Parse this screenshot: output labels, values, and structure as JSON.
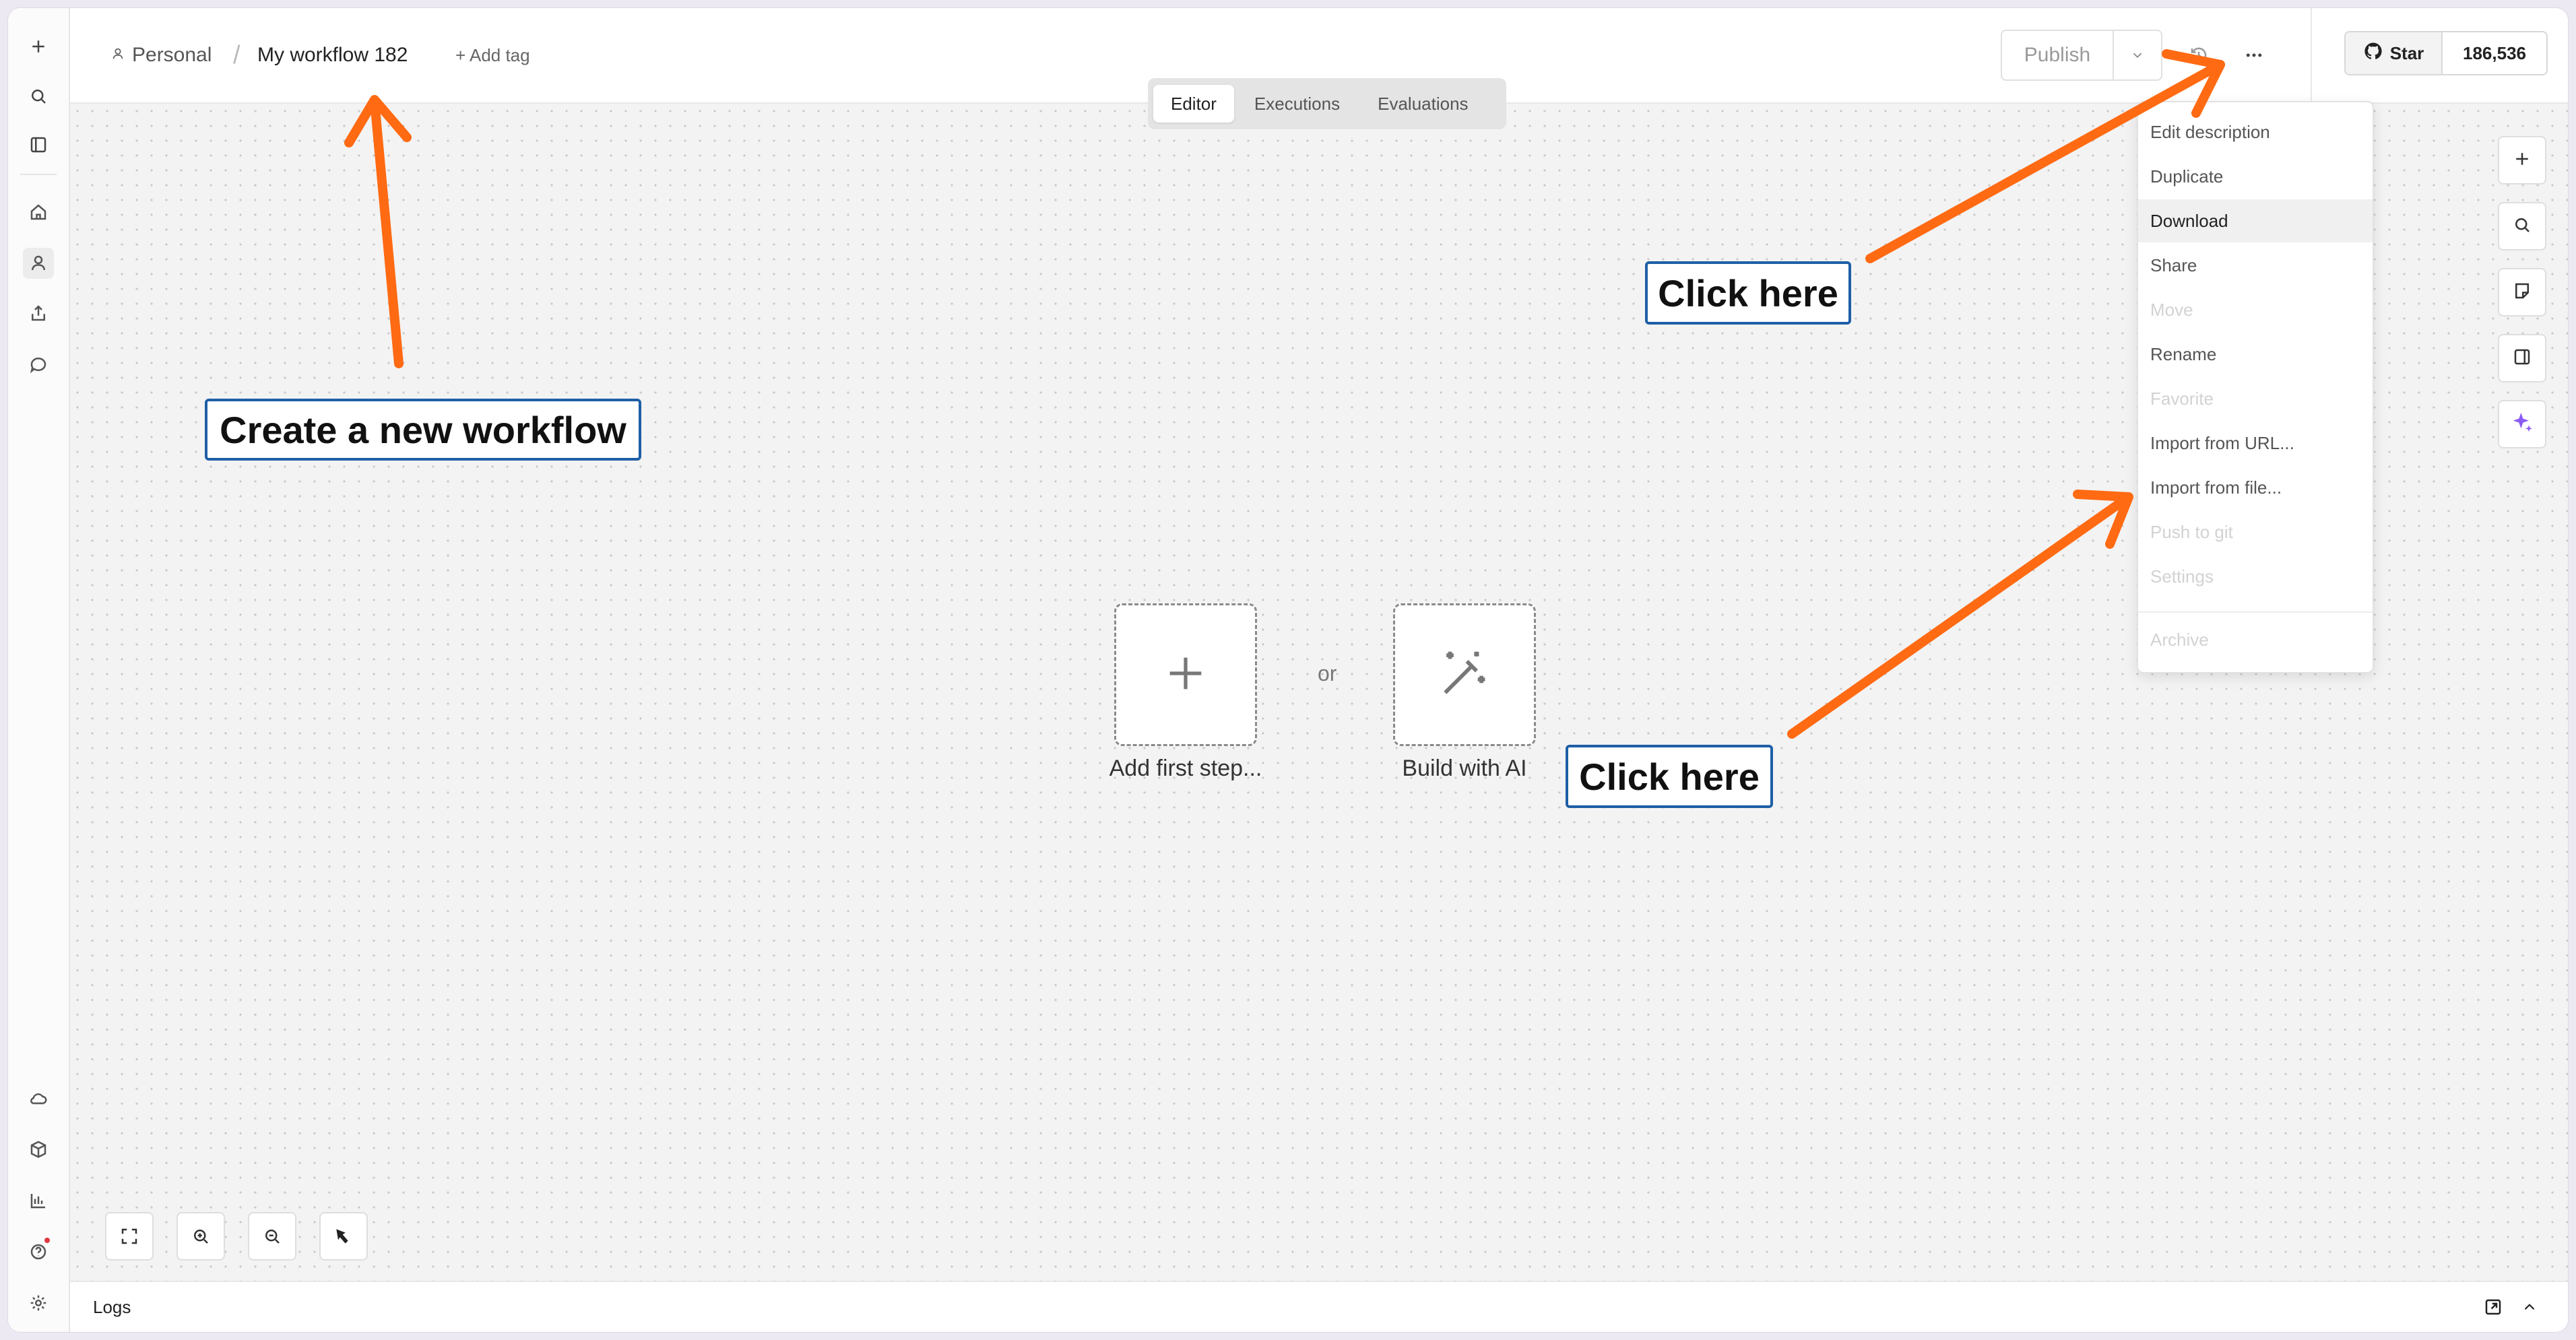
{
  "header": {
    "breadcrumb_project": "Personal",
    "breadcrumb_separator": "/",
    "workflow_name": "My workflow 182",
    "add_tag": "+ Add tag",
    "publish_label": "Publish",
    "github_star_label": "Star",
    "github_star_count": "186,536"
  },
  "tabs": [
    {
      "label": "Editor",
      "active": true
    },
    {
      "label": "Executions",
      "active": false
    },
    {
      "label": "Evaluations",
      "active": false
    }
  ],
  "canvas": {
    "add_first_step": "Add first step...",
    "or": "or",
    "build_with_ai": "Build with AI"
  },
  "menu": {
    "items": [
      {
        "label": "Edit description",
        "state": "normal"
      },
      {
        "label": "Duplicate",
        "state": "normal"
      },
      {
        "label": "Download",
        "state": "highlighted"
      },
      {
        "label": "Share",
        "state": "normal"
      },
      {
        "label": "Move",
        "state": "disabled"
      },
      {
        "label": "Rename",
        "state": "normal"
      },
      {
        "label": "Favorite",
        "state": "disabled"
      },
      {
        "label": "Import from URL...",
        "state": "normal"
      },
      {
        "label": "Import from file...",
        "state": "normal"
      },
      {
        "label": "Push to git",
        "state": "disabled"
      },
      {
        "label": "Settings",
        "state": "disabled"
      },
      {
        "label": "Archive",
        "state": "disabled"
      }
    ]
  },
  "logs": {
    "label": "Logs"
  },
  "annotations": {
    "create_workflow": "Create a new workflow",
    "click_here_top": "Click here",
    "click_here_bottom": "Click here"
  },
  "colors": {
    "annotation_arrow": "#ff6a13",
    "annotation_border": "#1e5fa6",
    "ai_sparkle": "#8b5cf6",
    "notification_dot": "#e0383e"
  },
  "icons": {
    "sidebar_top": [
      "plus-icon",
      "search-icon",
      "panel-icon"
    ],
    "sidebar_nav": [
      "home-icon",
      "user-icon",
      "share-icon",
      "chat-icon"
    ],
    "sidebar_bottom": [
      "cloud-icon",
      "cube-icon",
      "chart-icon",
      "help-icon",
      "gear-icon"
    ],
    "canvas_controls": [
      "fit-view-icon",
      "zoom-in-icon",
      "zoom-out-icon",
      "tidy-icon"
    ],
    "right_toolbar": [
      "plus-icon",
      "search-icon",
      "sticky-note-icon",
      "panel-icon",
      "ai-sparkle-icon"
    ]
  }
}
